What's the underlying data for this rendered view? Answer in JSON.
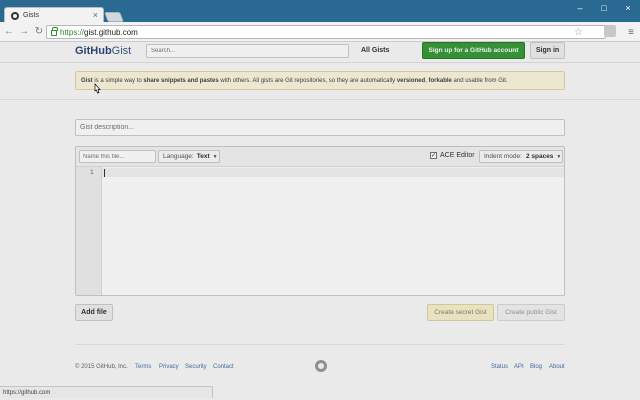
{
  "browser": {
    "tab_title": "Gists",
    "tab_close": "×",
    "window_buttons": [
      "–",
      "□",
      "×"
    ],
    "url_scheme": "https://",
    "url_host": "gist.github.com",
    "status_url": "https://github.com"
  },
  "header": {
    "logo_main": "GitHub",
    "logo_sub": "Gist",
    "search_placeholder": "Search...",
    "all_gists": "All Gists",
    "signup_label": "Sign up for a GitHub account",
    "signin_label": "Sign in"
  },
  "notice": {
    "parts": [
      "Gist",
      " is a simple way to ",
      "share snippets and pastes",
      " with others. All gists are Git repositories, so they are automatically ",
      "versioned",
      ", ",
      "forkable",
      " and usable from Git."
    ]
  },
  "form": {
    "description_placeholder": "Gist description...",
    "filename_placeholder": "Name this file...",
    "language_label": "Language:",
    "language_value": "Text",
    "ace_label": "ACE Editor",
    "ace_checked": true,
    "indent_label": "Indent mode:",
    "indent_value": "2 spaces",
    "line_number": "1",
    "add_file": "Add file",
    "create_secret": "Create secret Gist",
    "create_public": "Create public Gist"
  },
  "footer": {
    "copyright": "© 2015 GitHub, Inc.",
    "left_links": [
      "Terms",
      "Privacy",
      "Security",
      "Contact"
    ],
    "right_links": [
      "Status",
      "API",
      "Blog",
      "About"
    ]
  },
  "colors": {
    "signup_green": "#3a9a3a",
    "notice_bg": "#fcf6e0",
    "link_blue": "#4a72a8",
    "chrome_blue": "#2a6a92"
  }
}
